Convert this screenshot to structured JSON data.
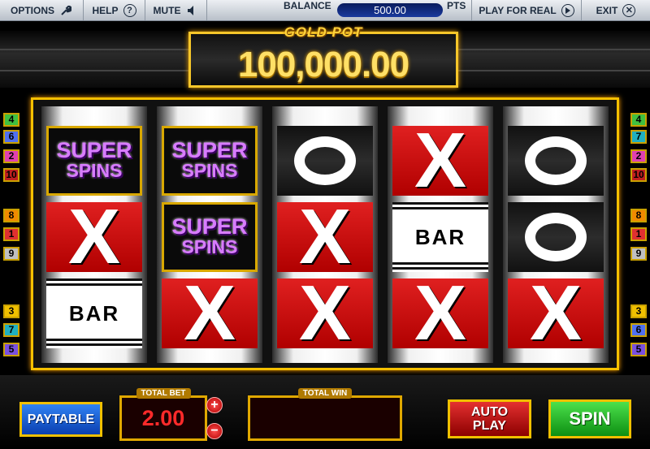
{
  "topbar": {
    "options_label": "OPTIONS",
    "help_label": "HELP",
    "help_glyph": "?",
    "mute_label": "MUTE",
    "balance_label": "BALANCE",
    "balance_value": "500.00",
    "balance_unit": "PTS",
    "play_real_label": "PLAY FOR REAL",
    "exit_label": "EXIT",
    "exit_glyph": "✕"
  },
  "goldpot": {
    "label": "GOLD POT",
    "amount": "100,000.00"
  },
  "paylines": {
    "left": [
      "4",
      "6",
      "2",
      "10",
      "8",
      "1",
      "9",
      "3",
      "7",
      "5"
    ],
    "right": [
      "4",
      "7",
      "2",
      "10",
      "8",
      "1",
      "9",
      "3",
      "6",
      "5"
    ],
    "colors": {
      "1": "#e03030",
      "2": "#e040b0",
      "3": "#f0c000",
      "4": "#40c040",
      "5": "#7a50e0",
      "6": "#5070f0",
      "7": "#20b0c0",
      "8": "#f08a00",
      "9": "#c0c0c0",
      "10": "#c02020"
    }
  },
  "reels": [
    [
      "super-spins",
      "x",
      "bar"
    ],
    [
      "super-spins",
      "super-spins",
      "x"
    ],
    [
      "o",
      "x",
      "x"
    ],
    [
      "x",
      "bar",
      "x"
    ],
    [
      "o",
      "o",
      "x"
    ]
  ],
  "symbols": {
    "x": "X",
    "bar": "BAR",
    "super_line1": "SUPER",
    "super_line2": "SPINS"
  },
  "bottom": {
    "paytable_label": "PAYTABLE",
    "totalbet_label": "TOTAL BET",
    "totalbet_value": "2.00",
    "bet_up_glyph": "+",
    "bet_down_glyph": "−",
    "totalwin_label": "TOTAL WIN",
    "totalwin_value": "",
    "autoplay_line1": "AUTO",
    "autoplay_line2": "PLAY",
    "spin_label": "SPIN"
  },
  "icons": {
    "options": "wrench-icon",
    "help": "question-icon",
    "mute": "speaker-icon",
    "play_real": "play-icon",
    "exit": "close-icon"
  }
}
